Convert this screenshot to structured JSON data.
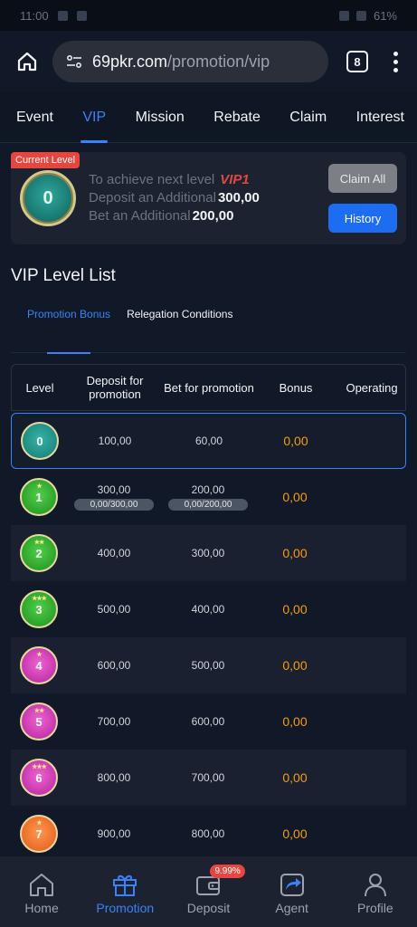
{
  "status_bar": {
    "time": "11:00",
    "battery": "61%"
  },
  "browser": {
    "url_domain": "69pkr.com",
    "url_path": "/promotion/vip",
    "tab_count": "8"
  },
  "nav_tabs": [
    {
      "label": "Event",
      "active": false
    },
    {
      "label": "VIP",
      "active": true
    },
    {
      "label": "Mission",
      "active": false
    },
    {
      "label": "Rebate",
      "active": false
    },
    {
      "label": "Claim",
      "active": false
    },
    {
      "label": "Interest",
      "active": false
    }
  ],
  "level_card": {
    "badge": "Current Level",
    "current_level": "0",
    "next_label": "To achieve next level",
    "next_level": "VIP1",
    "deposit_label": "Deposit an Additional",
    "deposit_value": "300,00",
    "bet_label": "Bet an Additional",
    "bet_value": "200,00",
    "claim_all": "Claim All",
    "history": "History"
  },
  "section_title": "VIP Level List",
  "sub_tabs": [
    {
      "label": "Promotion Bonus",
      "active": true
    },
    {
      "label": "Relegation Conditions",
      "active": false
    }
  ],
  "table": {
    "headers": {
      "level": "Level",
      "deposit": "Deposit for promotion",
      "bet": "Bet for promotion",
      "bonus": "Bonus",
      "operating": "Operating"
    },
    "rows": [
      {
        "level": "0",
        "deposit": "100,00",
        "bet": "60,00",
        "bonus": "0,00",
        "deposit_progress": "",
        "bet_progress": ""
      },
      {
        "level": "1",
        "deposit": "300,00",
        "bet": "200,00",
        "bonus": "0,00",
        "deposit_progress": "0,00/300,00",
        "bet_progress": "0,00/200,00"
      },
      {
        "level": "2",
        "deposit": "400,00",
        "bet": "300,00",
        "bonus": "0,00",
        "deposit_progress": "",
        "bet_progress": ""
      },
      {
        "level": "3",
        "deposit": "500,00",
        "bet": "400,00",
        "bonus": "0,00",
        "deposit_progress": "",
        "bet_progress": ""
      },
      {
        "level": "4",
        "deposit": "600,00",
        "bet": "500,00",
        "bonus": "0,00",
        "deposit_progress": "",
        "bet_progress": ""
      },
      {
        "level": "5",
        "deposit": "700,00",
        "bet": "600,00",
        "bonus": "0,00",
        "deposit_progress": "",
        "bet_progress": ""
      },
      {
        "level": "6",
        "deposit": "800,00",
        "bet": "700,00",
        "bonus": "0,00",
        "deposit_progress": "",
        "bet_progress": ""
      },
      {
        "level": "7",
        "deposit": "900,00",
        "bet": "800,00",
        "bonus": "0,00",
        "deposit_progress": "",
        "bet_progress": ""
      }
    ]
  },
  "bottom_nav": [
    {
      "label": "Home",
      "icon": "home-icon",
      "active": false
    },
    {
      "label": "Promotion",
      "icon": "gift-icon",
      "active": true
    },
    {
      "label": "Deposit",
      "icon": "wallet-icon",
      "active": false,
      "badge": "9.99%"
    },
    {
      "label": "Agent",
      "icon": "share-icon",
      "active": false
    },
    {
      "label": "Profile",
      "icon": "user-icon",
      "active": false
    }
  ],
  "colors": {
    "accent": "#3b82f6",
    "bonus": "#f59e0b",
    "badge": "#e5463f",
    "background": "#111827"
  }
}
